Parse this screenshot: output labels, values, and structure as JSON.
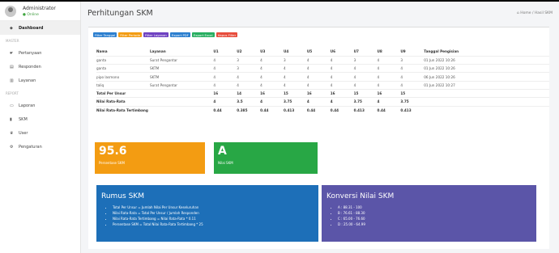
{
  "sidebar": {
    "user_name": "Administrator",
    "user_status": "Online",
    "items": [
      {
        "label": "Dashboard",
        "icon": "dashboard-icon",
        "glyph": "◆"
      },
      {
        "label": "MASTER",
        "heading": true
      },
      {
        "label": "Pertanyaan",
        "icon": "question-icon",
        "glyph": "☛"
      },
      {
        "label": "Responden",
        "icon": "responden-icon",
        "glyph": "▤"
      },
      {
        "label": "Layanan",
        "icon": "layanan-icon",
        "glyph": "▥"
      },
      {
        "label": "REPORT",
        "heading": true
      },
      {
        "label": "Laporan",
        "icon": "laporan-icon",
        "glyph": "▭"
      },
      {
        "label": "SKM",
        "icon": "chart-icon",
        "glyph": "▮"
      },
      {
        "label": "User",
        "icon": "user-icon",
        "glyph": "♛"
      },
      {
        "label": "Pengaturan",
        "icon": "gear-icon",
        "glyph": "⚙"
      }
    ]
  },
  "header": {
    "title": "Perhitungan SKM",
    "breadcrumb": "Home / Hasil SKM"
  },
  "toolbar": [
    {
      "label": "Filter Tanggal",
      "color": "#2c7fcf"
    },
    {
      "label": "Filter Periode",
      "color": "#f39c12"
    },
    {
      "label": "Filter Layanan",
      "color": "#6f42c1"
    },
    {
      "label": "Export PDF",
      "color": "#2c7fcf"
    },
    {
      "label": "Export Excel",
      "color": "#27ae60"
    },
    {
      "label": "Hapus Filter",
      "color": "#e74c3c"
    }
  ],
  "table": {
    "headers": [
      "Nama",
      "Layanan",
      "U1",
      "U2",
      "U3",
      "U4",
      "U5",
      "U6",
      "U7",
      "U8",
      "U9",
      "Tanggal Pengisian"
    ],
    "rows": [
      [
        "ganta",
        "Surat Pengantar",
        "4",
        "3",
        "4",
        "3",
        "4",
        "4",
        "3",
        "4",
        "3",
        "01 Jun 2022 10:26"
      ],
      [
        "ganta",
        "SKTM",
        "4",
        "3",
        "4",
        "4",
        "4",
        "4",
        "4",
        "4",
        "4",
        "01 Jun 2022 10:26"
      ],
      [
        "pipo lasmono",
        "SKTM",
        "4",
        "4",
        "4",
        "4",
        "4",
        "4",
        "4",
        "4",
        "4",
        "06 Jun 2022 10:26"
      ],
      [
        "taliq",
        "Surat Pengantar",
        "4",
        "4",
        "4",
        "4",
        "4",
        "4",
        "4",
        "4",
        "4",
        "01 Jun 2022 10:27"
      ]
    ],
    "summary": [
      [
        "Total Per Unsur",
        "16",
        "14",
        "16",
        "15",
        "16",
        "16",
        "15",
        "16",
        "15"
      ],
      [
        "Nilai Rata-Rata",
        "4",
        "3.5",
        "4",
        "3.75",
        "4",
        "4",
        "3.75",
        "4",
        "3.75"
      ],
      [
        "Nilai Rata-Rata Tertimbang",
        "0.44",
        "0.385",
        "0.44",
        "0.413",
        "0.44",
        "0.44",
        "0.413",
        "0.44",
        "0.413"
      ]
    ]
  },
  "tiles": {
    "persentase": {
      "value": "95.6",
      "label": "Persentase SKM",
      "color": "#f39c12"
    },
    "nilai": {
      "value": "A",
      "label": "Nilai SKM",
      "color": "#28a745"
    }
  },
  "rumus": {
    "title": "Rumus SKM",
    "color": "#1d6fb8",
    "items": [
      "Total Per Unsur = Jumlah Nilai Per Unsur Keseluruhan",
      "Nilai Rata-Rata = Total Per Unsur / Jumlah Responden",
      "Nilai Rata-Rata Tertimbang = Nilai Rata-Rata * 0.11",
      "Persentase SKM = Total Nilai Rata-Rata Tertimbang * 25"
    ]
  },
  "konversi": {
    "title": "Konversi Nilai SKM",
    "color": "#5b55a8",
    "items": [
      "A : 88.31 - 100",
      "B : 76.61 - 88.30",
      "C : 65.00 - 76.60",
      "D : 25.00 - 64.99"
    ]
  }
}
